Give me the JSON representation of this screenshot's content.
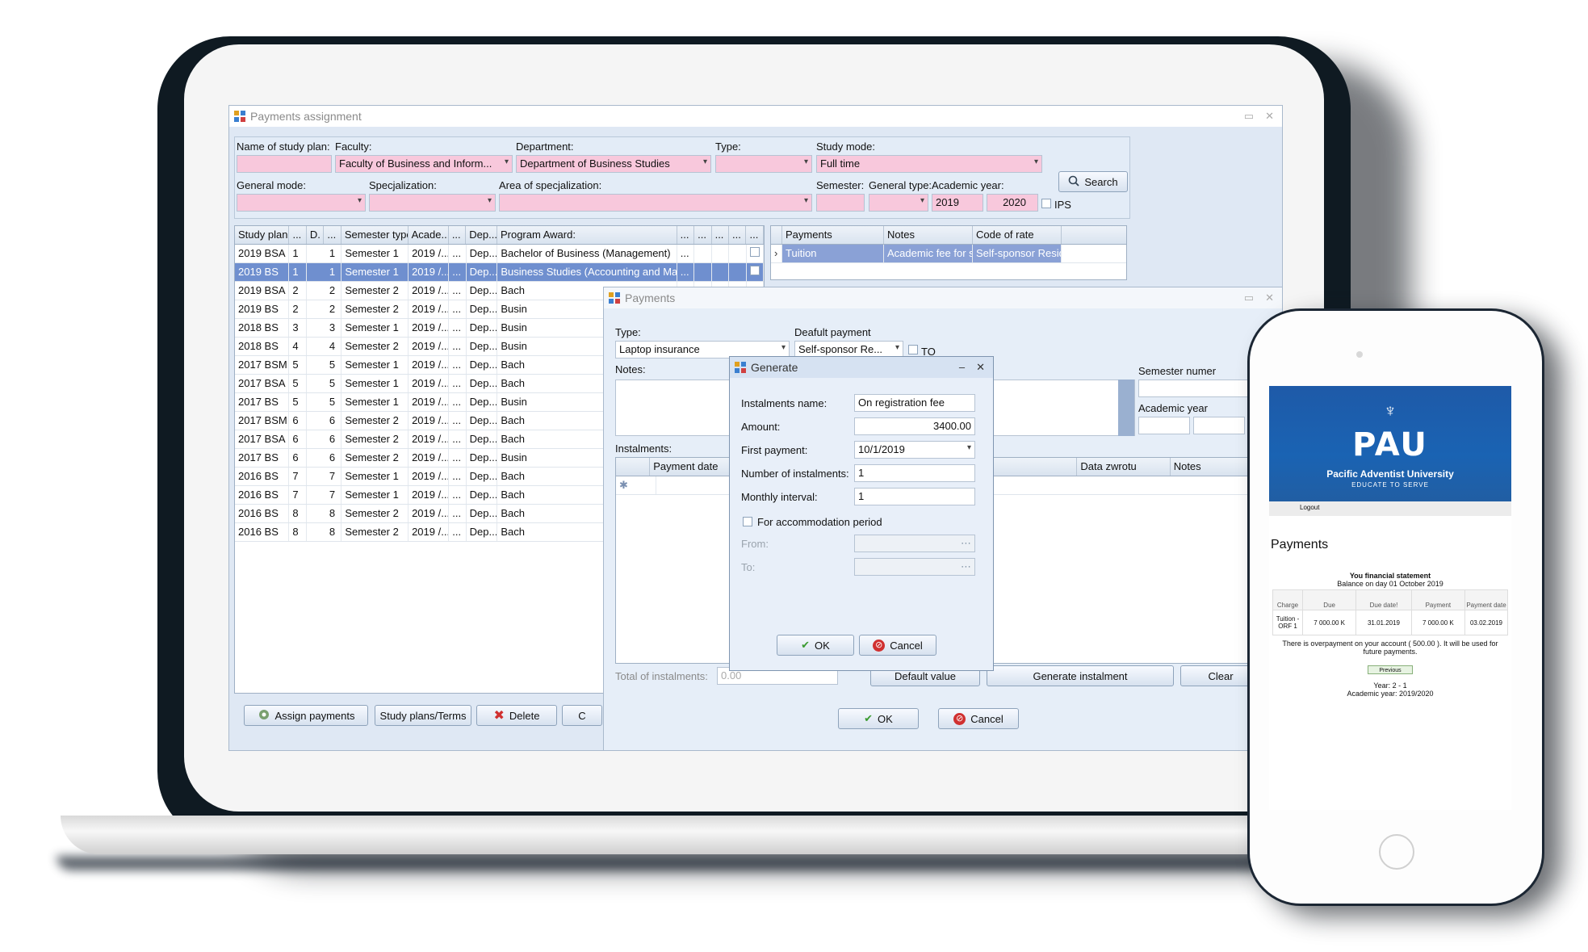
{
  "main": {
    "title": "Payments assignment",
    "filters": {
      "study_plan_label": "Name of study plan:",
      "faculty_label": "Faculty:",
      "faculty_value": "Faculty of Business and Inform...",
      "department_label": "Department:",
      "department_value": "Department of Business Studies",
      "type_label": "Type:",
      "study_mode_label": "Study mode:",
      "study_mode_value": "Full time",
      "general_mode_label": "General mode:",
      "specjalization_label": "Specjalization:",
      "area_label": "Area of specjalization:",
      "semester_label": "Semester:",
      "general_type_label": "General type:",
      "academic_year_label": "Academic year:",
      "year_from": "2019",
      "year_to": "2020",
      "ips_label": "IPS",
      "search_label": "Search"
    },
    "grid": {
      "columns": [
        "Study plan",
        "...",
        "D.",
        "...",
        "Semester type",
        "Acade...",
        "...",
        "Dep...",
        "Program Award:",
        "...",
        "...",
        "...",
        "...",
        "..."
      ],
      "rows": [
        [
          "2019 BSA",
          "1",
          "1",
          "Semester 1",
          "2019 /...",
          "...",
          "Dep...",
          "Bachelor of Business (Management)",
          "..."
        ],
        [
          "2019 BS",
          "1",
          "1",
          "Semester 1",
          "2019 /...",
          "...",
          "Dep...",
          "Business Studies (Accounting and Management)",
          "..."
        ],
        [
          "2019 BSA",
          "2",
          "2",
          "Semester 2",
          "2019 /...",
          "...",
          "Dep...",
          "Bach",
          ""
        ],
        [
          "2019 BS",
          "2",
          "2",
          "Semester 2",
          "2019 /...",
          "...",
          "Dep...",
          "Busin",
          ""
        ],
        [
          "2018 BS",
          "3",
          "3",
          "Semester 1",
          "2019 /...",
          "...",
          "Dep...",
          "Busin",
          ""
        ],
        [
          "2018 BS",
          "4",
          "4",
          "Semester 2",
          "2019 /...",
          "...",
          "Dep...",
          "Busin",
          ""
        ],
        [
          "2017 BSM",
          "5",
          "5",
          "Semester 1",
          "2019 /...",
          "...",
          "Dep...",
          "Bach",
          ""
        ],
        [
          "2017 BSA",
          "5",
          "5",
          "Semester 1",
          "2019 /...",
          "...",
          "Dep...",
          "Bach",
          ""
        ],
        [
          "2017 BS",
          "5",
          "5",
          "Semester 1",
          "2019 /...",
          "...",
          "Dep...",
          "Busin",
          ""
        ],
        [
          "2017 BSM",
          "6",
          "6",
          "Semester 2",
          "2019 /...",
          "...",
          "Dep...",
          "Bach",
          ""
        ],
        [
          "2017 BSA",
          "6",
          "6",
          "Semester 2",
          "2019 /...",
          "...",
          "Dep...",
          "Bach",
          ""
        ],
        [
          "2017 BS",
          "6",
          "6",
          "Semester 2",
          "2019 /...",
          "...",
          "Dep...",
          "Busin",
          ""
        ],
        [
          "2016 BS",
          "7",
          "7",
          "Semester 1",
          "2019 /...",
          "...",
          "Dep...",
          "Bach",
          ""
        ],
        [
          "2016 BS",
          "7",
          "7",
          "Semester 1",
          "2019 /...",
          "...",
          "Dep...",
          "Bach",
          ""
        ],
        [
          "2016 BS",
          "8",
          "8",
          "Semester 2",
          "2019 /...",
          "...",
          "Dep...",
          "Bach",
          ""
        ],
        [
          "2016 BS",
          "8",
          "8",
          "Semester 2",
          "2019 /...",
          "...",
          "Dep...",
          "Bach",
          ""
        ]
      ]
    },
    "right_grid": {
      "columns": [
        "Payments",
        "Notes",
        "Code of rate"
      ],
      "row": [
        "Tuition",
        "Academic fee for s...",
        "Self-sponsor Reside..."
      ]
    },
    "buttons": {
      "assign": "Assign payments",
      "study_plans": "Study plans/Terms",
      "delete": "Delete",
      "extra": "C"
    }
  },
  "payments": {
    "title": "Payments",
    "type_label": "Type:",
    "type_value": "Laptop insurance",
    "default_label": "Deafult payment",
    "default_value": "Self-sponsor Re...",
    "to_label": "TO",
    "notes_label": "Notes:",
    "semester_label": "Semester numer",
    "academic_year_label": "Academic year",
    "instalments_label": "Instalments:",
    "inst_columns": [
      "Payment date",
      "Data zwrotu",
      "Notes"
    ],
    "total_label": "Total of instalments:",
    "total_value": "0.00",
    "default_value_btn": "Default value",
    "generate_btn": "Generate instalment",
    "clear_btn": "Clear",
    "ok": "OK",
    "cancel": "Cancel"
  },
  "generate": {
    "title": "Generate",
    "name_label": "Instalments name:",
    "name_value": "On registration fee",
    "amount_label": "Amount:",
    "amount_value": "3400.00",
    "first_label": "First payment:",
    "first_value": "10/1/2019",
    "number_label": "Number of instalments:",
    "number_value": "1",
    "interval_label": "Monthly interval:",
    "interval_value": "1",
    "accommodation_label": "For accommodation period",
    "from_label": "From:",
    "to_label": "To:",
    "ok": "OK",
    "cancel": "Cancel"
  },
  "phone": {
    "university": "Pacific Adventist University",
    "motto": "EDUCATE TO SERVE",
    "logo": "PAU",
    "logout": "Logout",
    "heading": "Payments",
    "statement_title": "You financial statement",
    "balance": "Balance on day 01 October 2019",
    "columns": [
      "Charge",
      "Due",
      "Due date!",
      "Payment",
      "Payment date"
    ],
    "row": [
      "Tuition - ORF 1",
      "7 000.00 K",
      "31.01.2019",
      "7 000.00 K",
      "03.02.2019"
    ],
    "overpayment": "There is overpayment on your account ( 500.00 ). It will be used for future payments.",
    "previous": "Previous",
    "year": "Year: 2 - 1",
    "academic_year": "Academic year: 2019/2020"
  }
}
